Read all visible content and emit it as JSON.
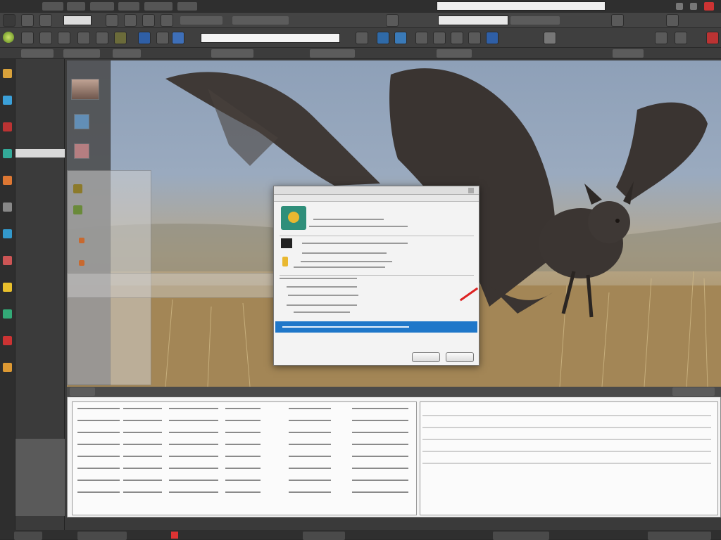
{
  "app": {
    "title": "",
    "menu_items": [
      "",
      "",
      "",
      "",
      "",
      ""
    ],
    "address_value": "",
    "search_value": ""
  },
  "toolbar": {
    "row1_icons": [
      "app-icon",
      "layers-icon",
      "document-icon",
      "copy-icon",
      "image-icon",
      "share-icon",
      "globe-icon",
      "tag-icon",
      "folder-icon",
      "trash-icon"
    ],
    "row2_icons": [
      "back-icon",
      "forward-icon",
      "person-icon",
      "refresh-icon",
      "edit-icon",
      "layers-icon",
      "info-icon",
      "image-icon",
      "globe-icon",
      "network-icon",
      "help-icon",
      "close-icon"
    ],
    "field_value": ""
  },
  "left_panel": {
    "items": [
      {
        "icon": "hammer-icon",
        "color": "#d9a23b"
      },
      {
        "icon": "globe-icon",
        "color": "#3ba0d9"
      },
      {
        "icon": "doc-icon",
        "color": "#b33"
      },
      {
        "icon": "chart-icon",
        "color": "#3a9"
      },
      {
        "icon": "cube-icon",
        "color": "#d73"
      },
      {
        "icon": "gear-icon",
        "color": "#888"
      },
      {
        "icon": "mail-icon",
        "color": "#39c"
      },
      {
        "icon": "photo-icon",
        "color": "#c55"
      },
      {
        "icon": "music-icon",
        "color": "#e9c02c"
      },
      {
        "icon": "shield-icon",
        "color": "#3a7"
      },
      {
        "icon": "flag-icon",
        "color": "#c33"
      },
      {
        "icon": "star-icon",
        "color": "#d93"
      }
    ]
  },
  "dialog": {
    "title": "",
    "heading": "",
    "subheading": "",
    "highlight_text": "",
    "ok_label": "",
    "cancel_label": ""
  },
  "bottom_panel": {
    "tab_label": "",
    "columns": [
      "",
      "",
      "",
      "",
      ""
    ],
    "rows": 8
  },
  "status_bar": {
    "items": [
      "",
      "",
      "",
      "",
      ""
    ]
  },
  "colors": {
    "selection": "#1f77c9",
    "chrome": "#4a4a4a",
    "panel": "#f4f4f4"
  }
}
